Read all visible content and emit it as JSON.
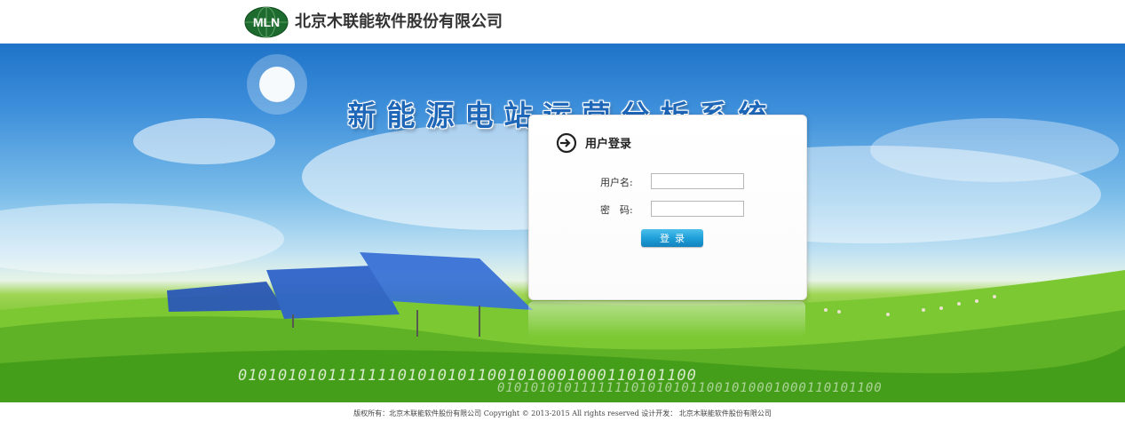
{
  "header": {
    "logo_text": "MLN",
    "company_name": "北京木联能软件股份有限公司"
  },
  "banner": {
    "system_title": "新能源电站运营分析系统",
    "binary_line_1": "0101010101111111010101011001010001000110101100",
    "binary_line_2": "0101010101111111010101011001010001000110101100"
  },
  "login": {
    "title": "用户登录",
    "username_label": "用户名:",
    "username_value": "",
    "password_label": "密　码:",
    "password_value": "",
    "submit_label": "登录"
  },
  "footer": {
    "text": "版权所有：北京木联能软件股份有限公司 Copyright © 2013-2015 All rights reserved 设计开发： 北京木联能软件股份有限公司"
  },
  "colors": {
    "title_blue": "#1d66b8",
    "button_blue": "#1f9fd8",
    "logo_green": "#1e6b2f"
  }
}
